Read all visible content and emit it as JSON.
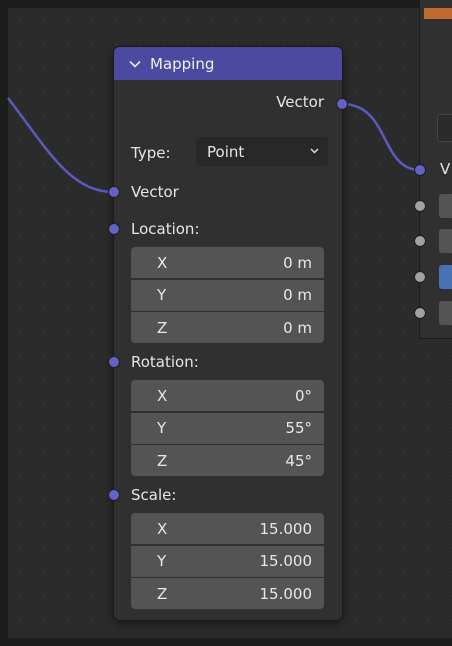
{
  "node": {
    "title": "Mapping",
    "output_label": "Vector",
    "type_label": "Type:",
    "type_value": "Point",
    "vector_input_label": "Vector",
    "location": {
      "label": "Location:",
      "fields": [
        {
          "axis": "X",
          "value": "0 m"
        },
        {
          "axis": "Y",
          "value": "0 m"
        },
        {
          "axis": "Z",
          "value": "0 m"
        }
      ]
    },
    "rotation": {
      "label": "Rotation:",
      "fields": [
        {
          "axis": "X",
          "value": "0°"
        },
        {
          "axis": "Y",
          "value": "55°"
        },
        {
          "axis": "Z",
          "value": "45°"
        }
      ]
    },
    "scale": {
      "label": "Scale:",
      "fields": [
        {
          "axis": "X",
          "value": "15.000"
        },
        {
          "axis": "Y",
          "value": "15.000"
        },
        {
          "axis": "Z",
          "value": "15.000"
        }
      ]
    }
  },
  "next_node": {
    "input_label": "V"
  },
  "colors": {
    "header": "#4b4aa0",
    "vector_socket": "#6363c7",
    "wire": "#5b5bbf",
    "field_bg": "#545454",
    "node_bg": "#303030"
  },
  "icons": [
    "chevron-down-icon",
    "dropdown-arrow-icon"
  ]
}
